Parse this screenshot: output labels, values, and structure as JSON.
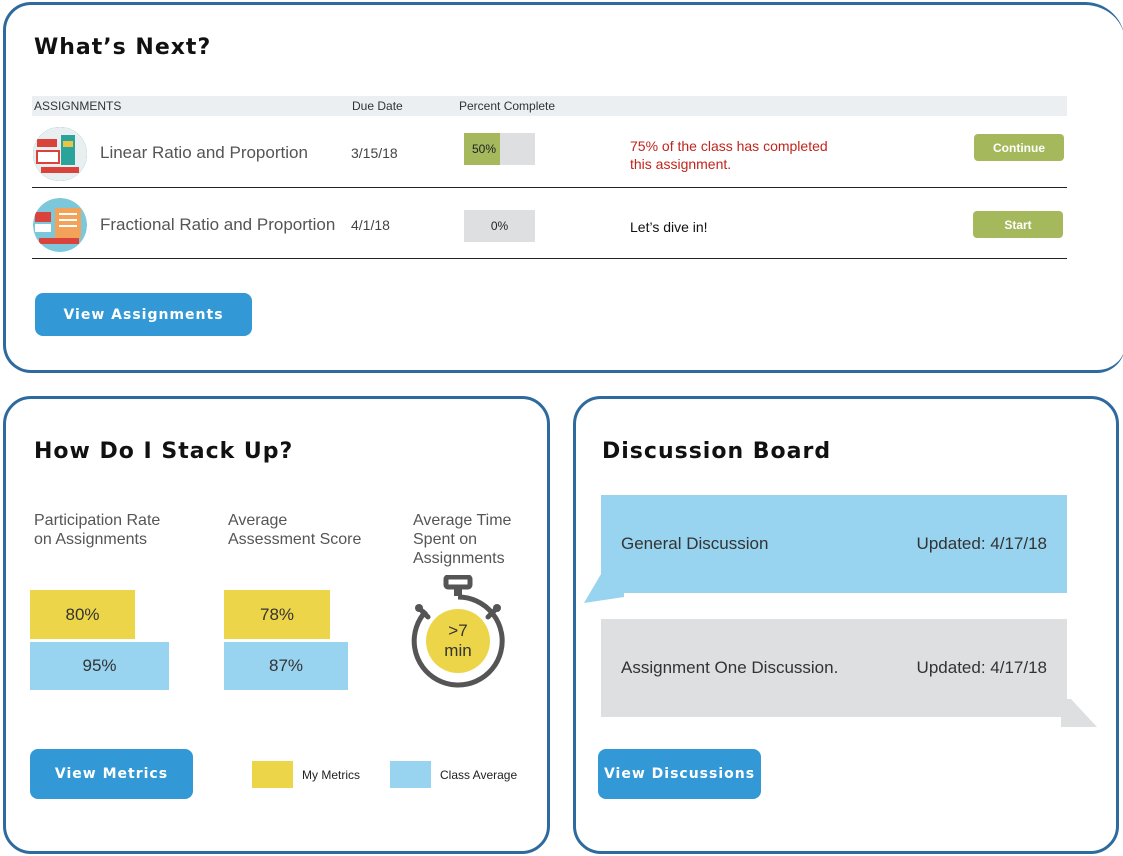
{
  "whats_next": {
    "title": "What’s Next?",
    "columns": {
      "assignments": "ASSIGNMENTS",
      "due_date": "Due Date",
      "percent_complete": "Percent Complete"
    },
    "assignments": [
      {
        "name": "Linear Ratio and Proportion",
        "due": "3/15/18",
        "percent": 50,
        "percent_label": "50%",
        "status_line1": "75% of the class has completed",
        "status_line2": "this assignment.",
        "status_color": "#c0251c",
        "action_label": "Continue"
      },
      {
        "name": "Fractional Ratio and Proportion",
        "due": "4/1/18",
        "percent": 0,
        "percent_label": "0%",
        "status_line1": "Let’s dive in!",
        "status_line2": "",
        "status_color": "#111111",
        "action_label": "Start"
      }
    ],
    "view_button": "View Assignments"
  },
  "stack_up": {
    "title": "How Do I Stack Up?",
    "participation": {
      "label_line1": "Participation Rate",
      "label_line2": "on Assignments",
      "mine": "80%",
      "class": "95%"
    },
    "assessment": {
      "label_line1": "Average",
      "label_line2": "Assessment Score",
      "mine": "78%",
      "class": "87%"
    },
    "time": {
      "label_line1": "Average Time",
      "label_line2": "Spent on",
      "label_line3": "Assignments",
      "value_line1": ">7",
      "value_line2": "min",
      "icon": "stopwatch-icon"
    },
    "view_button": "View Metrics",
    "legend": {
      "mine": "My Metrics",
      "class": "Class Average"
    },
    "colors": {
      "mine": "#edd54a",
      "class": "#98d3ef"
    }
  },
  "discussion": {
    "title": "Discussion Board",
    "items": [
      {
        "name": "General Discussion",
        "updated": "Updated: 4/17/18",
        "color": "#98d3ef"
      },
      {
        "name": "Assignment One Discussion.",
        "updated": "Updated: 4/17/18",
        "color": "#dedfe0"
      }
    ],
    "view_button": "View Discussions"
  },
  "colors": {
    "border": "#2e6a9e",
    "button_blue": "#3399d6",
    "button_green": "#a5b85c"
  }
}
